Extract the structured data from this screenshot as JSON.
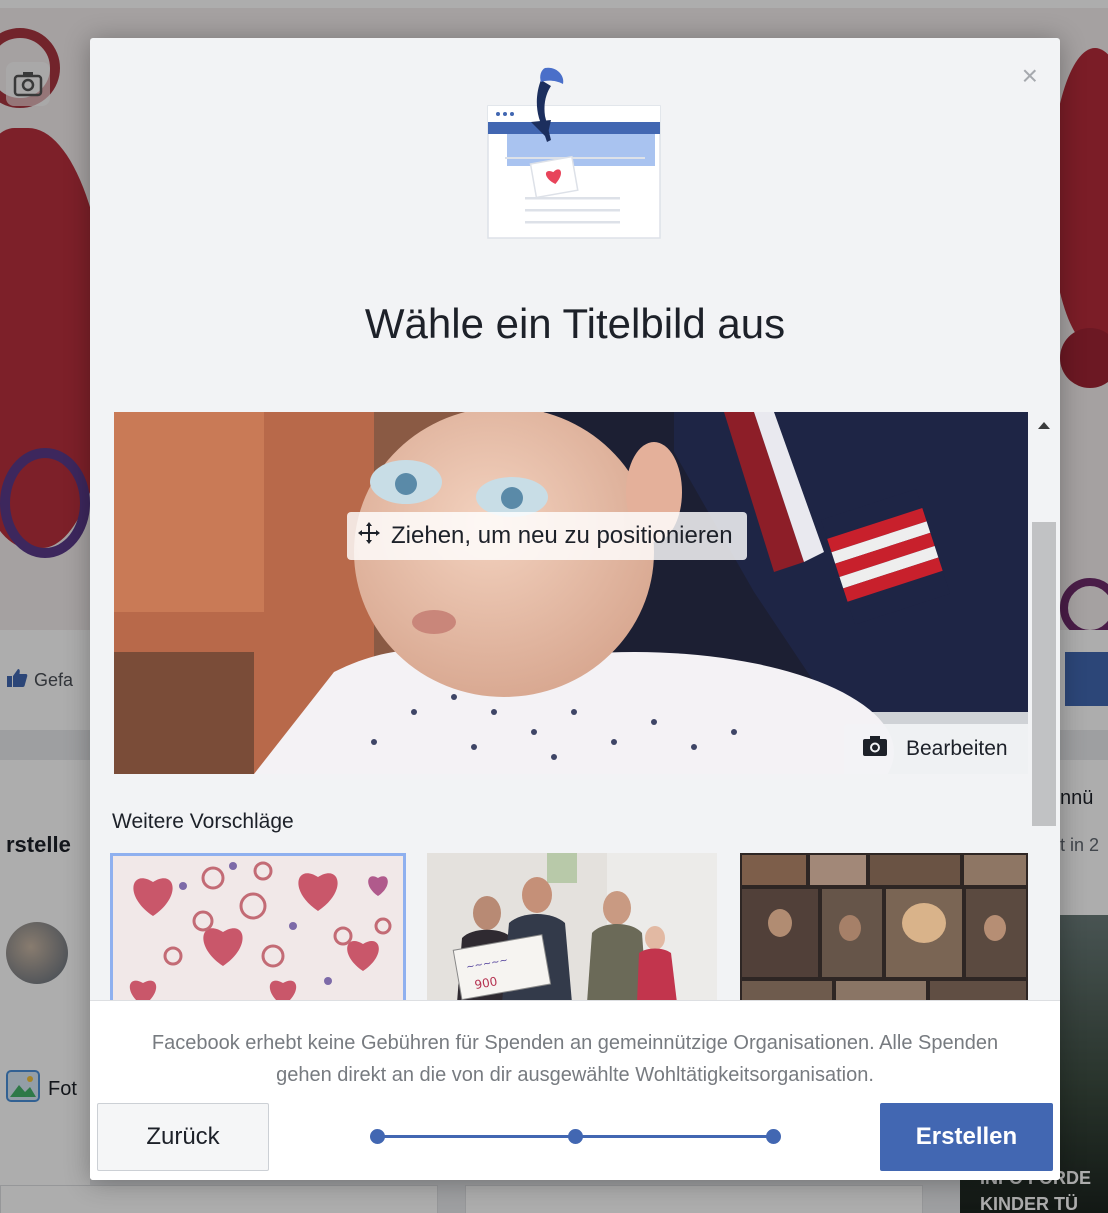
{
  "background": {
    "like_label": "Gefa",
    "left_heading": "rstelle",
    "foto_label": "Fot",
    "right_text_1": "nnü",
    "right_text_2": "t in 2",
    "photo_caption_1": "INFO FÖRDE",
    "photo_caption_2": "KINDER TÜ"
  },
  "modal": {
    "close_label": "×",
    "title": "Wähle ein Titelbild aus",
    "cover": {
      "drag_hint": "Ziehen, um neu zu positionieren",
      "edit_label": "Bearbeiten"
    },
    "suggestions": {
      "heading": "Weitere Vorschläge",
      "selected_index": 0
    },
    "footer": {
      "disclaimer": "Facebook erhebt keine Gebühren für Spenden an gemeinnützige Organisationen. Alle Spenden gehen direkt an die von dir ausgewählte Wohltätigkeitsorganisation.",
      "back_label": "Zurück",
      "create_label": "Erstellen",
      "steps_total": 3
    }
  },
  "colors": {
    "accent": "#4267b2",
    "selected_border": "#8fb0ef",
    "heart": "#e8445a"
  }
}
